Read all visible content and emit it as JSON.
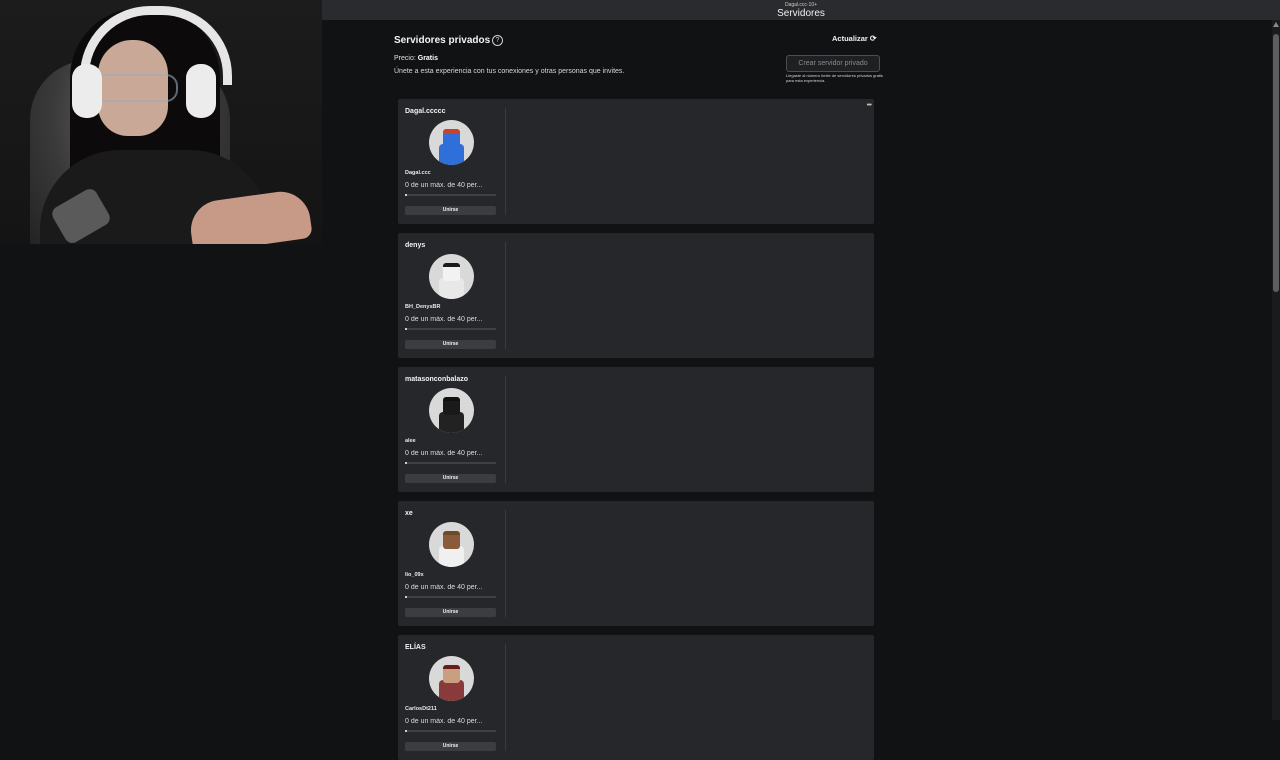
{
  "titlebar": {
    "subtitle": "Dagal.ccc·10+",
    "title": "Servidores"
  },
  "section": {
    "title": "Servidores privados",
    "price_label": "Precio:",
    "price_value": "Gratis",
    "description": "Únete a esta experiencia con tus conexiones y otras personas que invites.",
    "refresh_label": "Actualizar",
    "create_button": "Crear servidor privado",
    "limit_note": "Llegaste al número límite de servidores privados gratis para esta experiencia."
  },
  "servers": [
    {
      "owner": "Dagal.ccccc",
      "player": "Dagal.ccc",
      "capacity": "0 de un máx. de 40 per...",
      "join_label": "Unirse",
      "more": "•••",
      "fill": 0.02,
      "avatar_colors": {
        "head": "#2f6fd9",
        "body": "#2f6fd9",
        "hair": "#c8422a"
      }
    },
    {
      "owner": "denys",
      "player": "BH_DenysBR",
      "capacity": "0 de un máx. de 40 per...",
      "join_label": "Unirse",
      "fill": 0.02,
      "avatar_colors": {
        "head": "#f2f2f2",
        "body": "#e8e8e8",
        "hair": "#1a1a1a"
      }
    },
    {
      "owner": "matasonconbalazo",
      "player": "alee",
      "capacity": "0 de un máx. de 40 per...",
      "join_label": "Unirse",
      "fill": 0.02,
      "avatar_colors": {
        "head": "#1a1a1a",
        "body": "#222222",
        "hair": "#111111"
      }
    },
    {
      "owner": "xe",
      "player": "lio_09x",
      "capacity": "0 de un máx. de 40 per...",
      "join_label": "Unirse",
      "fill": 0.02,
      "avatar_colors": {
        "head": "#8a5a3a",
        "body": "#f0f0f0",
        "hair": "#6b4a2a"
      }
    },
    {
      "owner": "ELÍAS",
      "player": "CarlosDt211",
      "capacity": "0 de un máx. de 40 per...",
      "join_label": "Unirse",
      "fill": 0.02,
      "avatar_colors": {
        "head": "#c8a080",
        "body": "#8a3a3a",
        "hair": "#6a1a1a"
      }
    }
  ]
}
